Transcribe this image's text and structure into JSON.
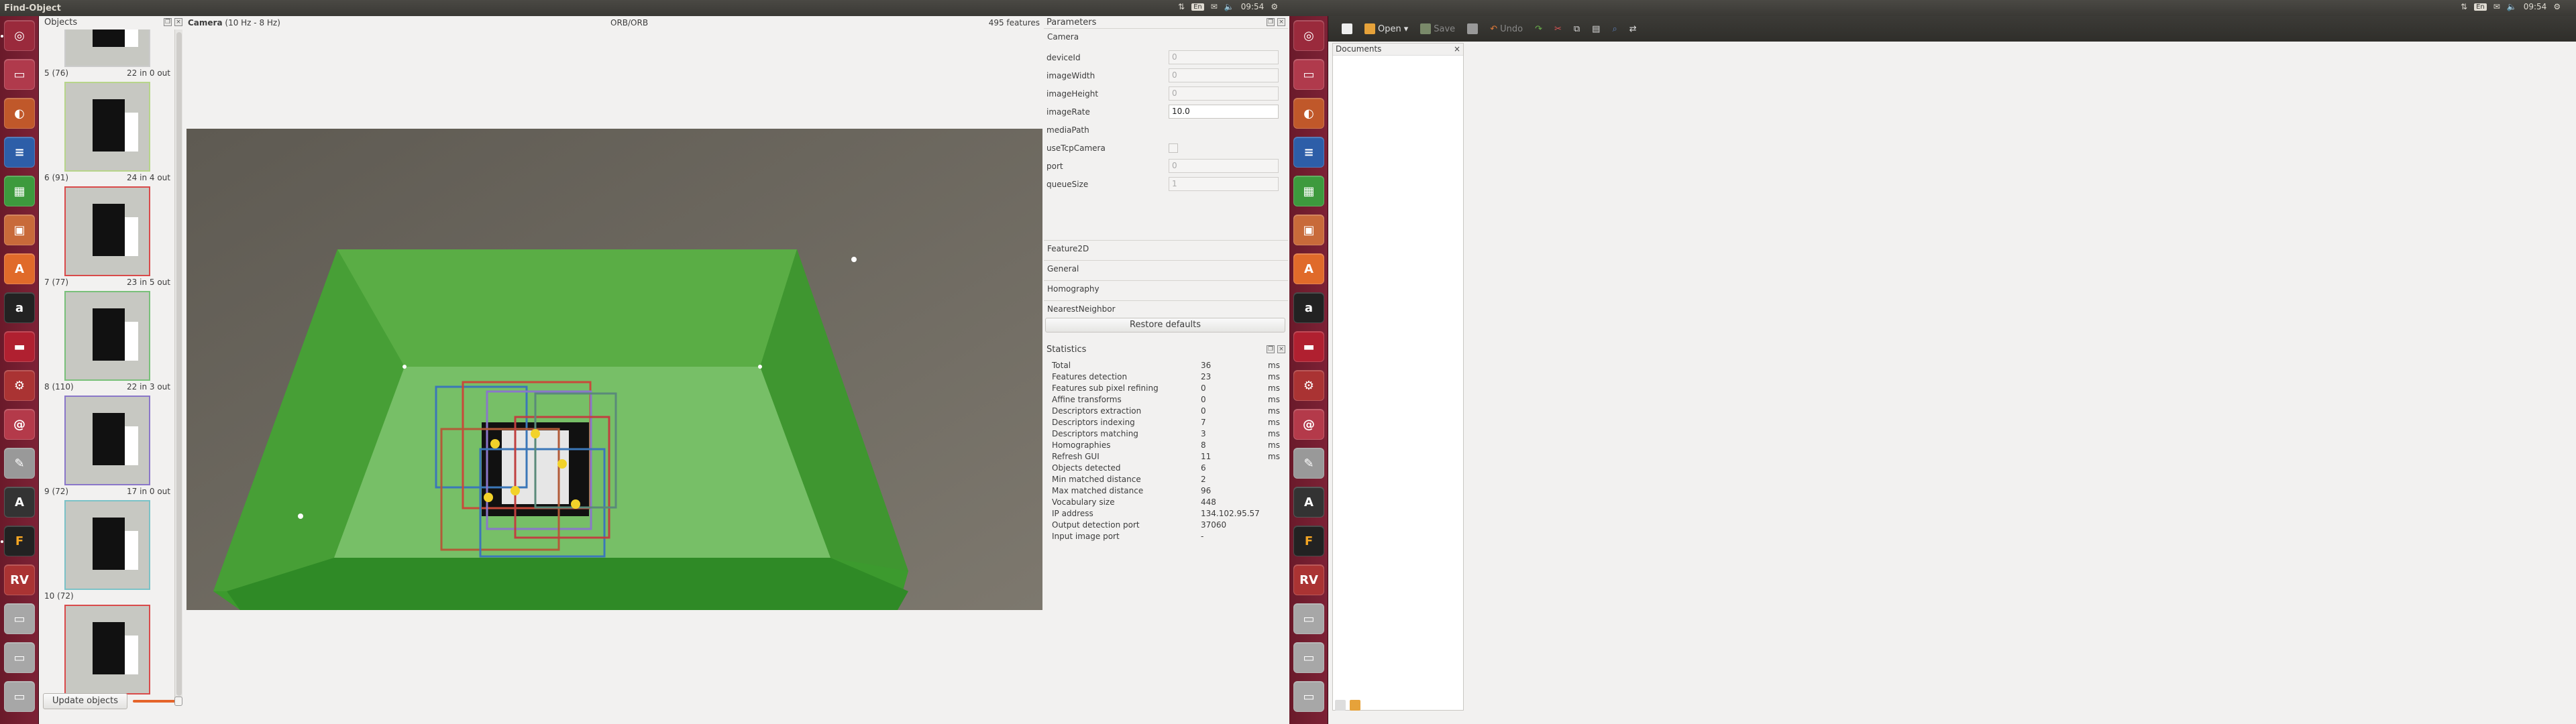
{
  "window_title": "Find-Object",
  "tray_left": {
    "keyboard": "En",
    "time": "09:54"
  },
  "tray_right": {
    "keyboard": "En",
    "time": "09:54"
  },
  "objects_panel": {
    "title": "Objects",
    "items": [
      {
        "label": "5 (76)",
        "count": "22 in 0 out"
      },
      {
        "label": "6 (91)",
        "count": "24 in 4 out"
      },
      {
        "label": "7 (77)",
        "count": "23 in 5 out"
      },
      {
        "label": "8 (110)",
        "count": "22 in 3 out"
      },
      {
        "label": "9 (72)",
        "count": "17 in 0 out"
      },
      {
        "label": "10 (72)",
        "count": ""
      }
    ],
    "update_button": "Update objects"
  },
  "camera_panel": {
    "title": "Camera",
    "fps": "(10 Hz - 8 Hz)",
    "detector": "ORB/ORB",
    "features": "495 features"
  },
  "parameters_panel": {
    "title": "Parameters",
    "sections": {
      "camera": "Camera",
      "feature2d": "Feature2D",
      "general": "General",
      "homography": "Homography",
      "nearest_neighbor": "NearestNeighbor"
    },
    "fields": [
      {
        "key": "deviceId",
        "value": "0"
      },
      {
        "key": "imageWidth",
        "value": "0"
      },
      {
        "key": "imageHeight",
        "value": "0"
      },
      {
        "key": "imageRate",
        "value": "10.0"
      },
      {
        "key": "mediaPath",
        "value": ""
      },
      {
        "key": "useTcpCamera",
        "value": ""
      },
      {
        "key": "port",
        "value": "0"
      },
      {
        "key": "queueSize",
        "value": "1"
      }
    ],
    "restore_button": "Restore defaults"
  },
  "statistics_panel": {
    "title": "Statistics",
    "rows": [
      {
        "key": "Total",
        "value": "36",
        "unit": "ms"
      },
      {
        "key": "Features detection",
        "value": "23",
        "unit": "ms"
      },
      {
        "key": "Features sub pixel refining",
        "value": "0",
        "unit": "ms"
      },
      {
        "key": "Affine transforms",
        "value": "0",
        "unit": "ms"
      },
      {
        "key": "Descriptors extraction",
        "value": "0",
        "unit": "ms"
      },
      {
        "key": "Descriptors indexing",
        "value": "7",
        "unit": "ms"
      },
      {
        "key": "Descriptors matching",
        "value": "3",
        "unit": "ms"
      },
      {
        "key": "Homographies",
        "value": "8",
        "unit": "ms"
      },
      {
        "key": "Refresh GUI",
        "value": "11",
        "unit": "ms"
      },
      {
        "key": "Objects detected",
        "value": "6",
        "unit": ""
      },
      {
        "key": "Min matched distance",
        "value": "2",
        "unit": ""
      },
      {
        "key": "Max matched distance",
        "value": "96",
        "unit": ""
      },
      {
        "key": "Vocabulary size",
        "value": "448",
        "unit": ""
      },
      {
        "key": "IP address",
        "value": "134.102.95.57",
        "unit": ""
      },
      {
        "key": "Output detection port",
        "value": "37060",
        "unit": ""
      },
      {
        "key": "Input image port",
        "value": "-",
        "unit": ""
      }
    ]
  },
  "editor_toolbar": {
    "open": "Open",
    "save": "Save",
    "undo": "Undo"
  },
  "documents_panel": {
    "title": "Documents"
  },
  "accent_colors": {
    "launcher": "#7d2236",
    "slider": "#e5642a",
    "green_box": "#4fa33a"
  }
}
